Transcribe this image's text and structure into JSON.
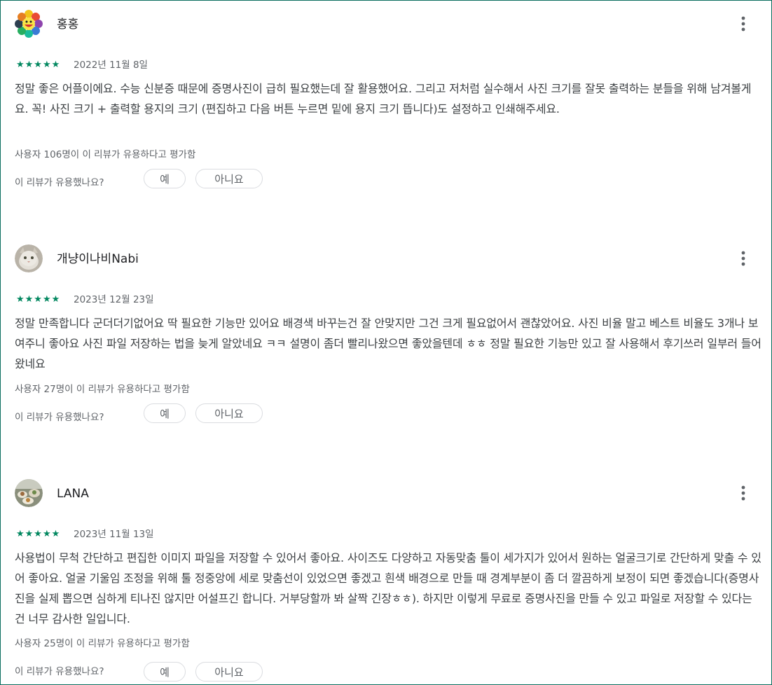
{
  "reviews": [
    {
      "author": "홍홍",
      "stars": "★★★★★",
      "date": "2022년 11월 8일",
      "body": "정말 좋은 어플이에요. 수능 신분증 때문에 증명사진이 급히 필요했는데 잘 활용했어요. 그리고 저처럼 실수해서 사진 크기를 잘못 출력하는 분들을 위해 남겨볼게요. 꼭! 사진 크기 + 출력할 용지의 크기 (편집하고 다음 버튼 누르면 밑에 용지 크기 뜹니다)도 설정하고 인쇄해주세요.",
      "helpful": "사용자 106명이 이 리뷰가 유용하다고 평가함",
      "question": "이 리뷰가 유용했나요?",
      "yes": "예",
      "no": "아니요"
    },
    {
      "author": "개냥이나비Nabi",
      "stars": "★★★★★",
      "date": "2023년 12월 23일",
      "body": "정말 만족합니다 군더더기없어요 딱 필요한 기능만 있어요 배경색 바꾸는건 잘 안맞지만 그건 크게 필요없어서 괜찮았어요. 사진 비율 말고 베스트 비율도 3개나 보여주니 좋아요 사진 파일 저장하는 법을 늦게 알았네요 ㅋㅋ 설명이 좀더 빨리나왔으면 좋았을텐데 ㅎㅎ 정말 필요한 기능만 있고 잘 사용해서 후기쓰러 일부러 들어왔네요",
      "helpful": "사용자 27명이 이 리뷰가 유용하다고 평가함",
      "question": "이 리뷰가 유용했나요?",
      "yes": "예",
      "no": "아니요"
    },
    {
      "author": "LANA",
      "stars": "★★★★★",
      "date": "2023년 11월 13일",
      "body": "사용법이 무척 간단하고 편집한 이미지 파일을 저장할 수 있어서 좋아요. 사이즈도 다양하고 자동맞춤 툴이 세가지가 있어서 원하는 얼굴크기로 간단하게 맞출 수 있어 좋아요. 얼굴 기울임 조정을 위해 툴 정중앙에 세로 맞춤선이 있었으면 좋겠고 흰색 배경으로 만들 때 경계부분이 좀 더 깔끔하게 보정이 되면 좋겠습니다(증명사진을 실제 뽑으면 심하게 티나진 않지만 어설프긴 합니다. 거부당할까 봐 살짝 긴장ㅎㅎ). 하지만 이렇게 무료로 증명사진을 만들 수 있고 파일로 저장할 수 있다는 건 너무 감사한 일입니다.",
      "helpful": "사용자 25명이 이 리뷰가 유용하다고 평가함",
      "question": "이 리뷰가 유용했나요?",
      "yes": "예",
      "no": "아니요"
    }
  ],
  "colors": {
    "star": "#01875f",
    "frame_border": "#0a6e5e"
  },
  "icons": [
    "more-vert-icon"
  ]
}
